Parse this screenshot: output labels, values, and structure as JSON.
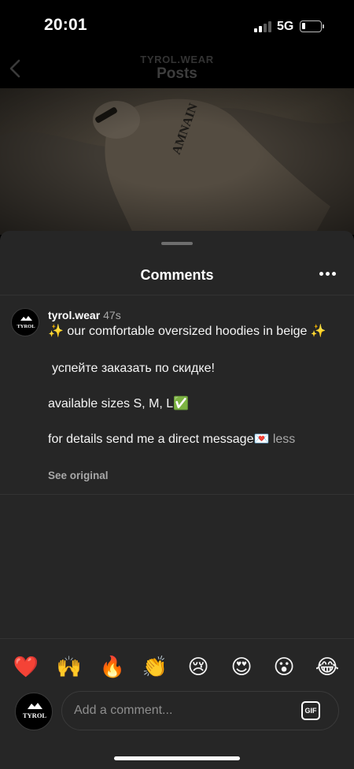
{
  "status_bar": {
    "time": "20:01",
    "network": "5G",
    "battery_level_percent": 20,
    "icons": [
      "signal-icon",
      "battery-icon"
    ]
  },
  "header": {
    "account": "TYROL.WEAR",
    "title": "Posts",
    "back_icon": "chevron-left-icon"
  },
  "comments_sheet": {
    "title": "Comments",
    "more_icon": "more-horizontal-icon"
  },
  "caption": {
    "username": "tyrol.wear",
    "time": "47s",
    "avatar_text": "TYROL",
    "lines": [
      "✨ our comfortable oversized hoodies in beige ✨",
      "успейте заказать по скидке!",
      "available sizes S, M, L✅",
      "for details send me a direct message💌"
    ],
    "less_label": "less",
    "see_original_label": "See original"
  },
  "reactions": [
    "❤️",
    "🙌",
    "🔥",
    "👏",
    "😢",
    "😍",
    "😮",
    "😂"
  ],
  "composer": {
    "avatar_text": "TYROL",
    "placeholder": "Add a comment...",
    "gif_label": "GIF"
  },
  "colors": {
    "sheet_background": "#262626",
    "app_background": "#000000",
    "secondary_text": "#a8a8a8"
  }
}
